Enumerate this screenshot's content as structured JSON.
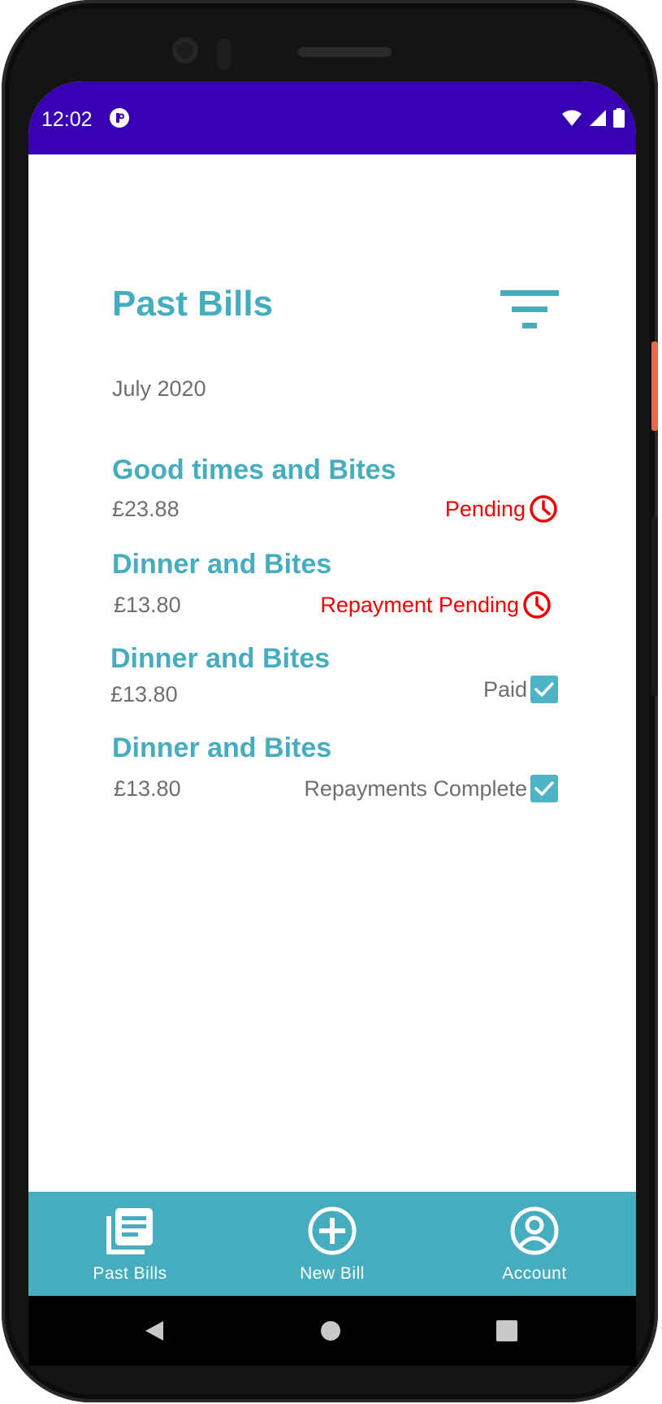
{
  "status_bar": {
    "time": "12:02",
    "app_icon": "app-notification-icon",
    "icons": [
      "wifi-icon",
      "cell-signal-icon",
      "battery-icon"
    ],
    "background": "#3700b3"
  },
  "header": {
    "title": "Past Bills",
    "filter_icon": "filter-icon"
  },
  "month_label": "July 2020",
  "bills": [
    {
      "name": "Good times and Bites",
      "amount": "£23.88",
      "status": "Pending",
      "status_icon": "clock-icon",
      "status_color": "#ee0000"
    },
    {
      "name": "Dinner and Bites",
      "amount": "£13.80",
      "status": "Repayment Pending",
      "status_icon": "clock-icon",
      "status_color": "#ee0000"
    },
    {
      "name": "Dinner and Bites",
      "amount": "£13.80",
      "status": "Paid",
      "status_icon": "checkbox-checked-icon",
      "status_color": "#6e6e6e"
    },
    {
      "name": "Dinner and Bites",
      "amount": "£13.80",
      "status": "Repayments Complete",
      "status_icon": "checkbox-checked-icon",
      "status_color": "#6e6e6e"
    }
  ],
  "bottom_nav": {
    "items": [
      {
        "label": "Past Bills",
        "icon": "receipt-list-icon"
      },
      {
        "label": "New Bill",
        "icon": "add-circle-icon"
      },
      {
        "label": "Account",
        "icon": "account-circle-icon"
      }
    ],
    "background": "#45adbd"
  },
  "system_nav": [
    "back-icon",
    "home-icon",
    "recents-icon"
  ],
  "colors": {
    "accent": "#45adbd",
    "pending": "#ee0000",
    "muted_text": "#6e6e6e",
    "checkbox": "#4db3c5"
  }
}
